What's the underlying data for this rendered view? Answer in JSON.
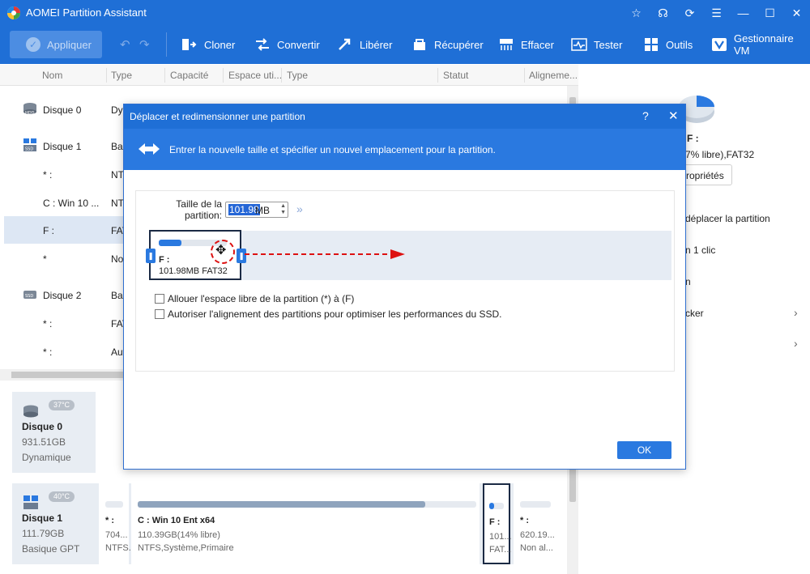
{
  "app": {
    "title": "AOMEI Partition Assistant"
  },
  "toolbar": {
    "apply_label": "Appliquer",
    "items": [
      {
        "label": "Cloner",
        "icon": "clone-icon"
      },
      {
        "label": "Convertir",
        "icon": "convert-icon"
      },
      {
        "label": "Libérer",
        "icon": "free-icon"
      },
      {
        "label": "Récupérer",
        "icon": "recover-icon"
      },
      {
        "label": "Effacer",
        "icon": "wipe-icon"
      },
      {
        "label": "Tester",
        "icon": "test-icon"
      },
      {
        "label": "Outils",
        "icon": "tools-icon"
      },
      {
        "label": "Gestionnaire VM",
        "icon": "vm-icon"
      }
    ]
  },
  "table": {
    "columns": [
      "Nom",
      "Type",
      "Capacité",
      "Espace uti...",
      "Type",
      "Statut",
      "Aligneme..."
    ],
    "rows": [
      {
        "name": "Disque 0",
        "type": "Dy",
        "kind": "disk"
      },
      {
        "name": "Disque 1",
        "type": "Ba",
        "kind": "disk-ssd"
      },
      {
        "name": "* :",
        "type": "NT",
        "kind": "part"
      },
      {
        "name": "C : Win 10 ...",
        "type": "NT",
        "kind": "part"
      },
      {
        "name": "F :",
        "type": "FAT",
        "kind": "part"
      },
      {
        "name": "*",
        "type": "No",
        "kind": "part"
      },
      {
        "name": "Disque 2",
        "type": "Ba",
        "kind": "disk-ssd"
      },
      {
        "name": "* :",
        "type": "FAT",
        "kind": "part"
      },
      {
        "name": "* :",
        "type": "Aut",
        "kind": "part"
      }
    ]
  },
  "diskmap": {
    "disk0": {
      "temp": "37°C",
      "name": "Disque 0",
      "size": "931.51GB",
      "type": "Dynamique"
    },
    "disk1": {
      "temp": "40°C",
      "name": "Disque 1",
      "size": "111.79GB",
      "type": "Basique GPT",
      "parts": [
        {
          "label": "* :",
          "size": "704...",
          "fs": "NTFS..."
        },
        {
          "label": "C : Win 10 Ent x64",
          "size": "110.39GB(14% libre)",
          "fs": "NTFS,Système,Primaire"
        },
        {
          "label": "F :",
          "size": "101...",
          "fs": "FAT..."
        },
        {
          "label": "* :",
          "size": "620.19...",
          "fs": "Non al..."
        }
      ]
    }
  },
  "rightpanel": {
    "drive": "F :",
    "info": "7% libre),FAT32",
    "props_label": "ropriétés",
    "ops": [
      "déplacer la partition",
      "n 1 clic",
      "n",
      "cker"
    ]
  },
  "dialog": {
    "title": "Déplacer et redimensionner une partition",
    "help": "?",
    "banner": "Entrer la nouvelle taille et spécifier un nouvel emplacement pour la partition.",
    "size_label": "Taille de la partition:",
    "size_value": "101.98",
    "size_unit": "MB",
    "part_label": "F :",
    "part_detail": "101.98MB FAT32",
    "check1": "Allouer l'espace libre de la partition (*) à (F)",
    "check2": "Autoriser l'alignement des partitions pour optimiser les performances du SSD.",
    "ok": "OK"
  }
}
